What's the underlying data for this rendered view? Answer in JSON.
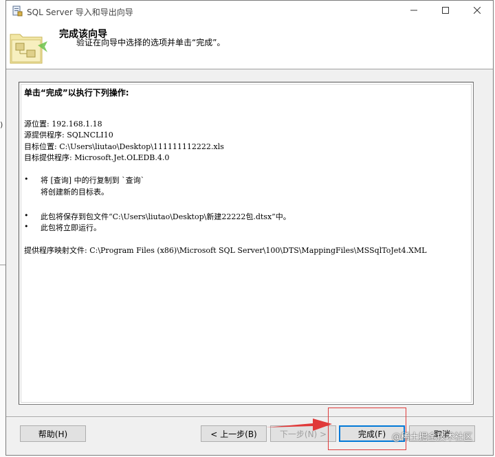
{
  "window": {
    "title": "SQL Server 导入和导出向导"
  },
  "header": {
    "title": "完成该向导",
    "subtitle": "验证在向导中选择的选项并单击“完成”。"
  },
  "summary": {
    "heading": "单击“完成”以执行下列操作:",
    "lines": [
      "源位置: 192.168.1.18",
      "源提供程序: SQLNCLI10",
      "目标位置: C:\\Users\\liutao\\Desktop\\111111112222.xls",
      "目标提供程序: Microsoft.Jet.OLEDB.4.0"
    ],
    "bullet_char": "•",
    "bullets": [
      {
        "text": "将 [查询] 中的行复制到 `查询`",
        "cont": "将创建新的目标表。"
      },
      {
        "text": "此包将保存到包文件“C:\\Users\\liutao\\Desktop\\新建22222包.dtsx”中。"
      },
      {
        "text": "此包将立即运行。"
      }
    ],
    "mapping": "提供程序映射文件: C:\\Program Files (x86)\\Microsoft SQL Server\\100\\DTS\\MappingFiles\\MSSqlToJet4.XML"
  },
  "buttons": {
    "help": "帮助(H)",
    "back": "< 上一步(B)",
    "next": "下一步(N) >",
    "finish": "完成(F)",
    "cancel": "取消"
  },
  "watermark": "@稀土掘金技术社区",
  "colors": {
    "accent_blue": "#0078d7",
    "annotation_red": "#e03a3a"
  }
}
